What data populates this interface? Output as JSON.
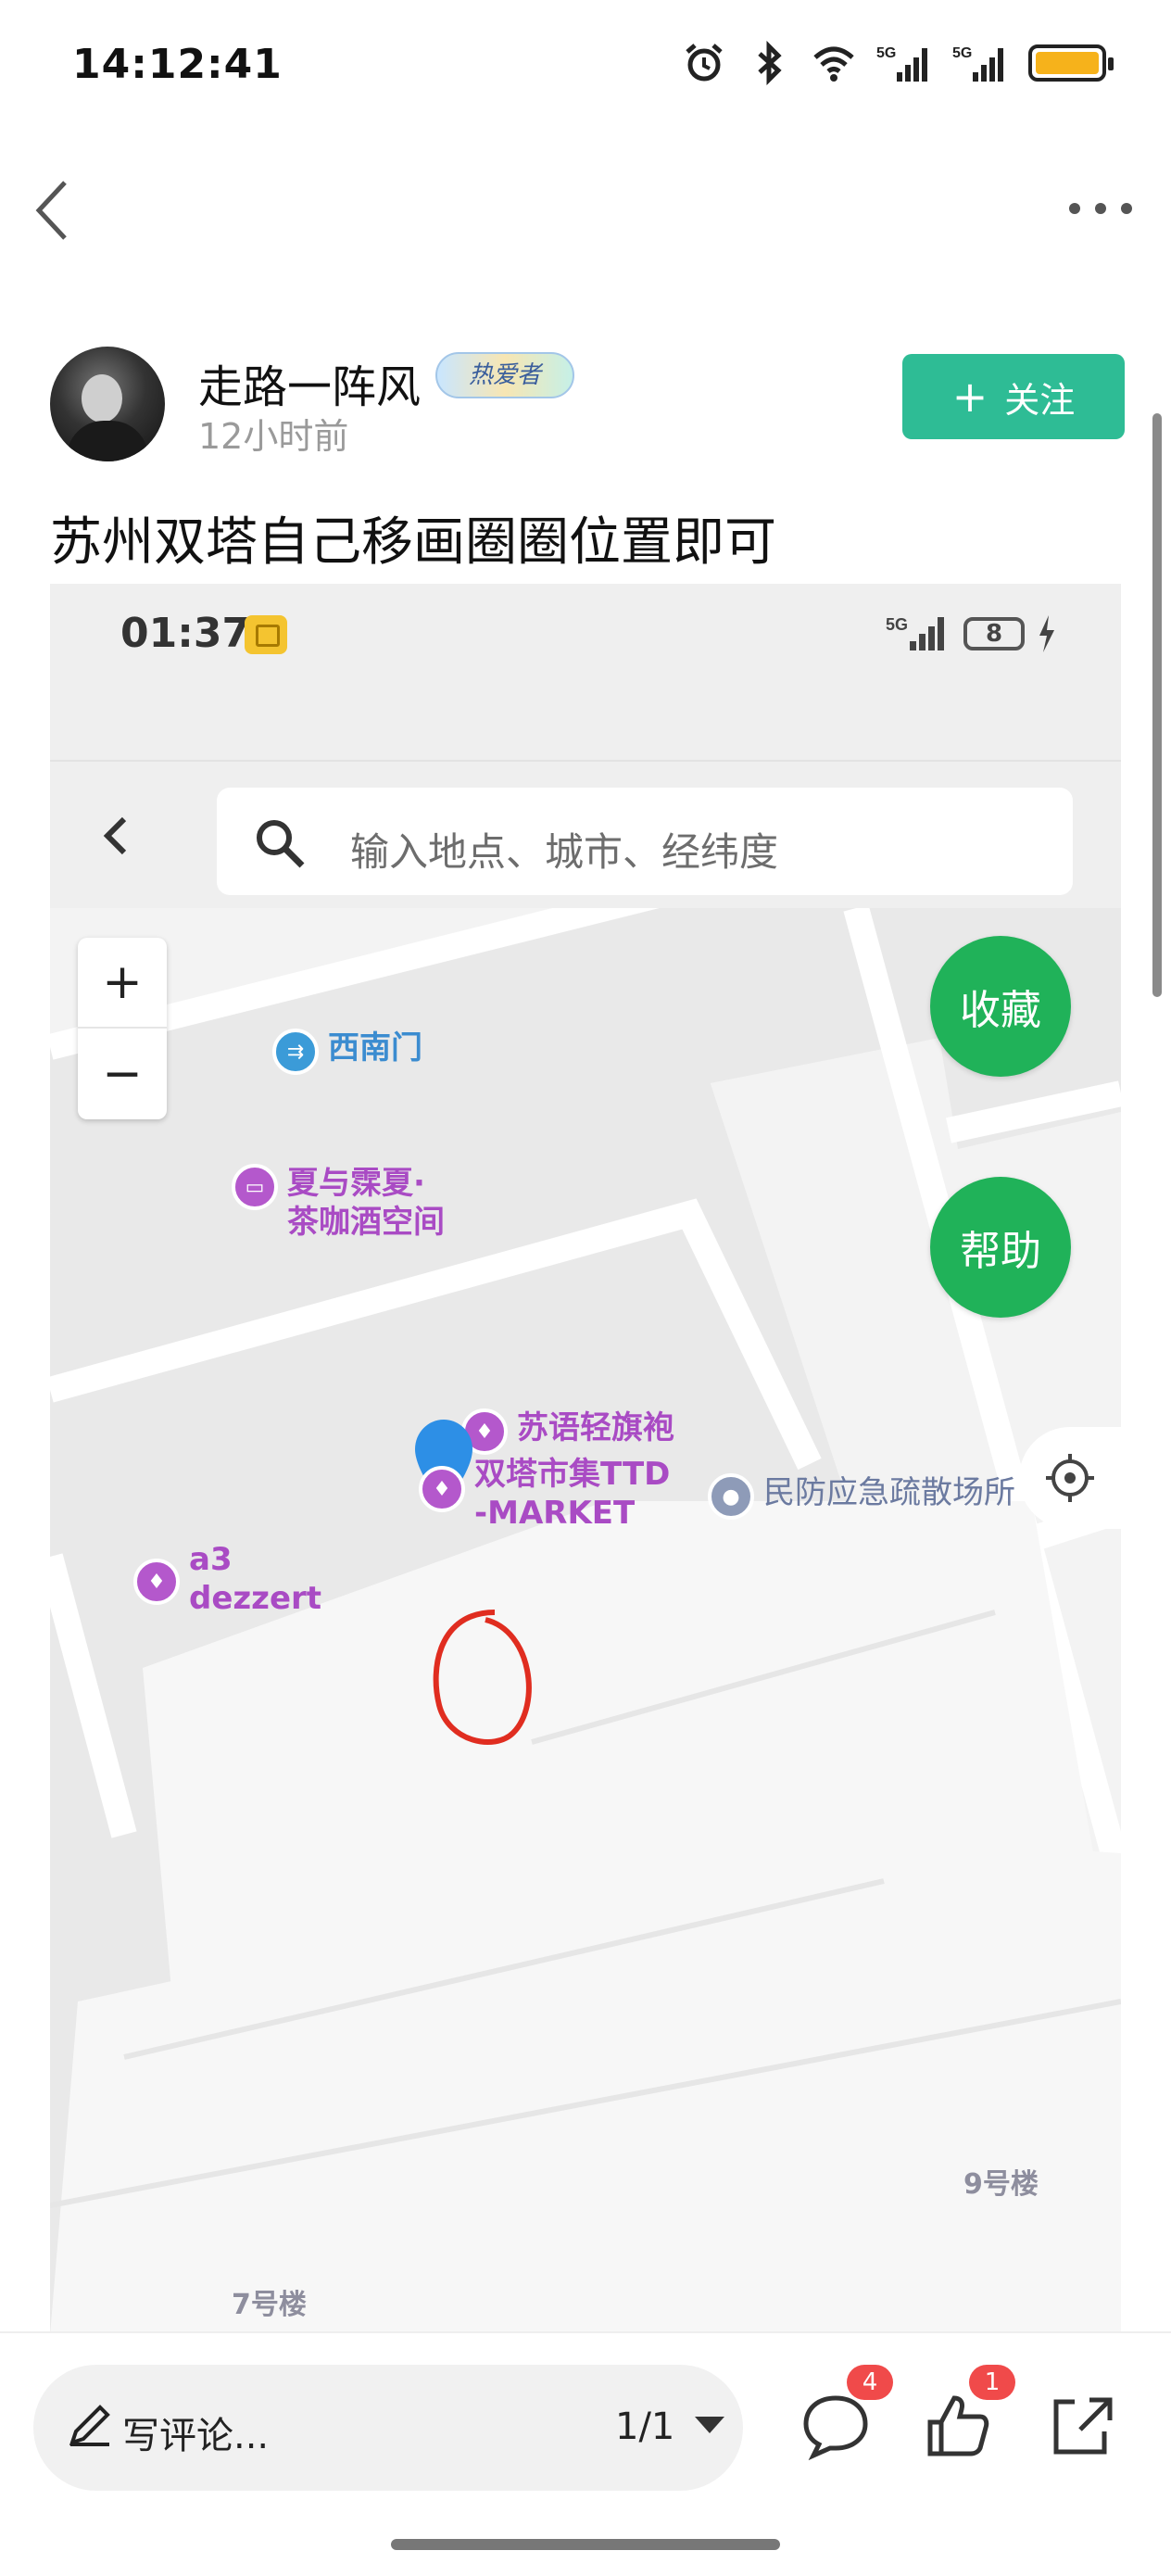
{
  "status_bar": {
    "time": "14:12:41",
    "battery_color": "#f6b21b"
  },
  "nav": {
    "back": "back",
    "more": "more"
  },
  "author": {
    "name": "走路一阵风",
    "badge": "热爱者",
    "time_ago": "12小时前",
    "follow_plus": "+",
    "follow_label": "关注"
  },
  "post": {
    "title": "苏州双塔自己移画圈圈位置即可"
  },
  "screenshot": {
    "time": "01:37",
    "battery_level": "8",
    "search_placeholder": "输入地点、城市、经纬度",
    "zoom_in": "+",
    "zoom_out": "−",
    "favorite_btn": "收藏",
    "help_btn": "帮助",
    "pois": {
      "southwest_gate": "西南门",
      "cafe_line1": "夏与霂夏·",
      "cafe_line2": "茶咖酒空间",
      "suyu": "苏语轻旗袍",
      "market_line1": "双塔市集TTD",
      "market_line2": "-MARKET",
      "shelter": "民防应急疏散场所",
      "a3_line1": "a3",
      "a3_line2": "dezzert"
    },
    "buildings": {
      "b9": "9号楼",
      "b7": "7号楼"
    },
    "accent_green": "#20b259"
  },
  "bottom_bar": {
    "comment_placeholder": "写评论...",
    "pager": "1/1",
    "comment_count": "4",
    "like_count": "1"
  }
}
